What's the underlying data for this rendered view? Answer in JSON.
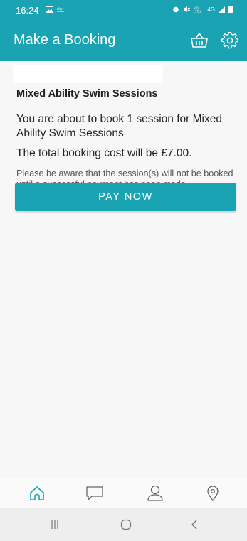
{
  "status_bar": {
    "time": "16:24",
    "left_icons": [
      "image-icon",
      "sky-news-icon"
    ],
    "right_icons": [
      "alarm-icon",
      "mute-icon",
      "volte-icon",
      "signal-icon",
      "battery-icon"
    ],
    "network_label": "4G"
  },
  "app_bar": {
    "title": "Make a Booking",
    "icons": [
      "basket-icon",
      "settings-icon"
    ]
  },
  "booking": {
    "session_title": "Mixed Ability Swim Sessions",
    "summary_text": "You are about to book 1 session for Mixed Ability Swim Sessions",
    "cost_text": "The total booking cost will be £7.00.",
    "note_text": "Please be aware that the session(s) will not be booked until a successful payment has been made.",
    "pay_button_label": "PAY NOW"
  },
  "bottom_nav": {
    "items": [
      "home-icon",
      "chat-icon",
      "profile-icon",
      "location-icon"
    ],
    "active": "home-icon"
  },
  "system_nav": {
    "items": [
      "recents-icon",
      "home-circle-icon",
      "back-icon"
    ]
  },
  "colors": {
    "primary": "#1aa3b3",
    "background": "#f7f7f7",
    "text": "#222222",
    "muted_text": "#555555"
  }
}
